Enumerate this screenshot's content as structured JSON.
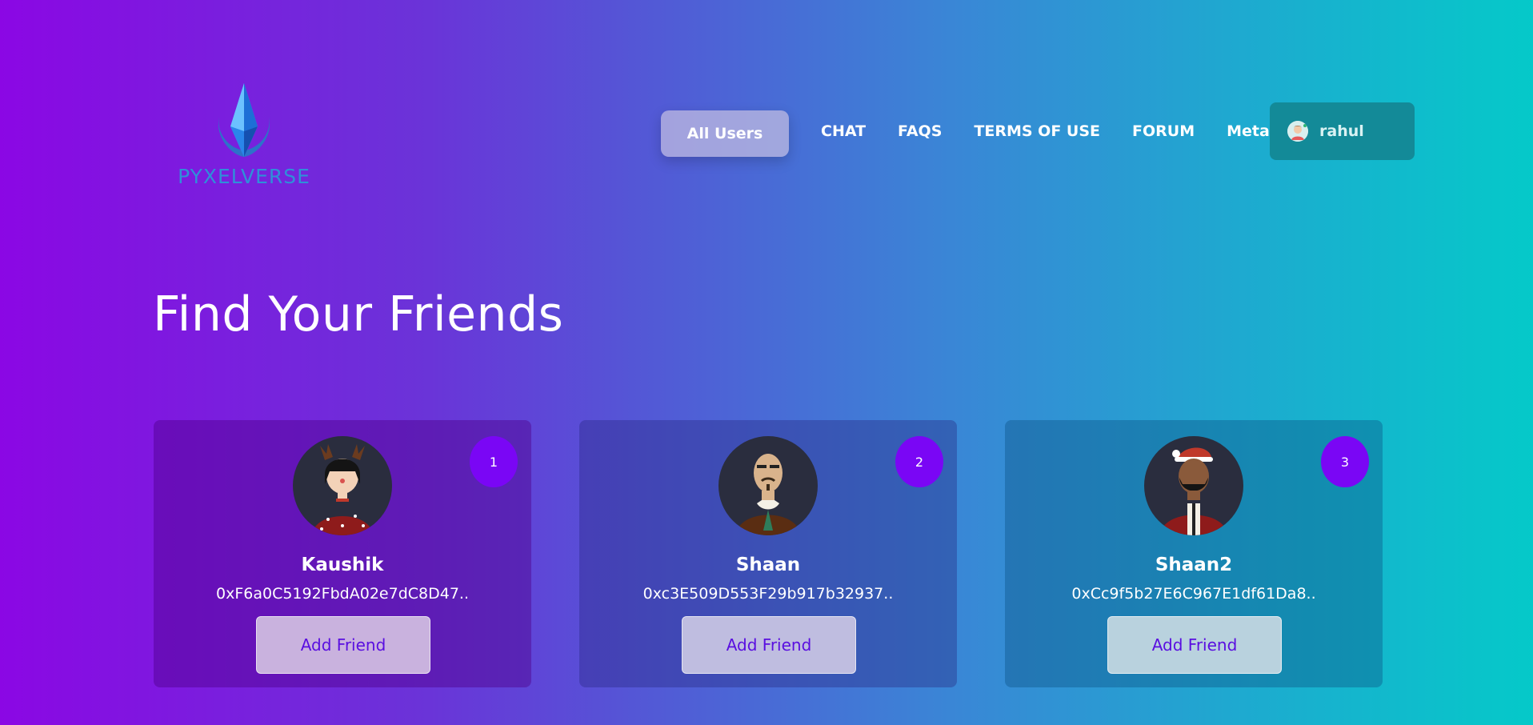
{
  "brand": {
    "name": "PYXELVERSE",
    "logo_icon": "diamond-crystal-icon",
    "logo_color": "#2f8fd9"
  },
  "nav": {
    "active_label": "All Users",
    "links": [
      "CHAT",
      "FAQS",
      "TERMS OF USE",
      "FORUM",
      "Meta"
    ]
  },
  "user": {
    "name": "rahul",
    "avatar_icon": "user-avatar-icon"
  },
  "page": {
    "title": "Find Your Friends"
  },
  "friends": [
    {
      "rank": "1",
      "name": "Kaushik",
      "address": "0xF6a0C5192FbdA02e7dC8D47..",
      "button_label": "Add Friend",
      "avatar_icon": "reindeer-girl-avatar-icon"
    },
    {
      "rank": "2",
      "name": "Shaan",
      "address": "0xc3E509D553F29b917b32937..",
      "button_label": "Add Friend",
      "avatar_icon": "bald-man-avatar-icon"
    },
    {
      "rank": "3",
      "name": "Shaan2",
      "address": "0xCc9f5b27E6C967E1df61Da8..",
      "button_label": "Add Friend",
      "avatar_icon": "santa-hat-man-avatar-icon"
    }
  ],
  "colors": {
    "badge": "#7a06f5",
    "button_text": "#5a0fe0",
    "user_chip": "#138a98"
  }
}
